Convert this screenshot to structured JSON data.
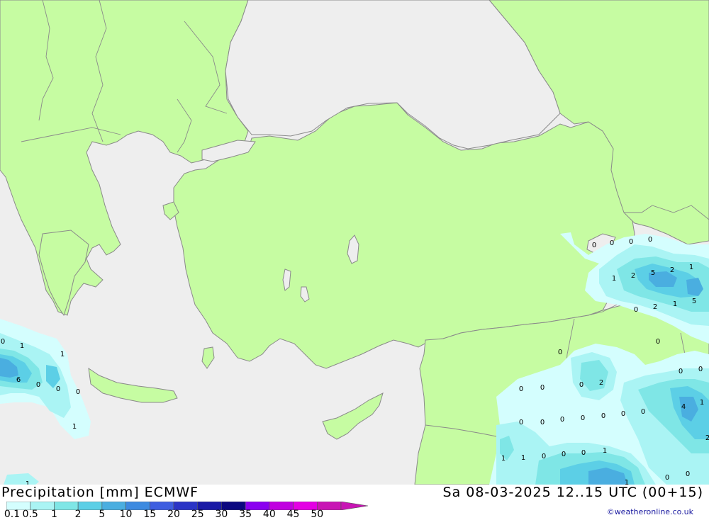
{
  "map": {
    "colors": {
      "sea": "#eeeeee",
      "land": "#c6fca2",
      "border": "#8a8a8a",
      "coast": "#8a8a8a"
    },
    "point_values": [
      {
        "label": "0"
      },
      {
        "label": "1"
      },
      {
        "label": "1"
      },
      {
        "label": "6"
      },
      {
        "label": "0"
      },
      {
        "label": "0"
      },
      {
        "label": "0"
      },
      {
        "label": "1"
      },
      {
        "label": "1"
      },
      {
        "label": "0"
      },
      {
        "label": "0"
      },
      {
        "label": "0"
      },
      {
        "label": "0"
      },
      {
        "label": "1"
      },
      {
        "label": "2"
      },
      {
        "label": "5"
      },
      {
        "label": "2"
      },
      {
        "label": "1"
      },
      {
        "label": "0"
      },
      {
        "label": "2"
      },
      {
        "label": "1"
      },
      {
        "label": "5"
      },
      {
        "label": "0"
      },
      {
        "label": "0"
      },
      {
        "label": "0"
      },
      {
        "label": "0"
      },
      {
        "label": "2"
      },
      {
        "label": "0"
      },
      {
        "label": "0"
      },
      {
        "label": "0"
      },
      {
        "label": "0"
      },
      {
        "label": "0"
      },
      {
        "label": "0"
      },
      {
        "label": "0"
      },
      {
        "label": "0"
      },
      {
        "label": "0"
      },
      {
        "label": "0"
      },
      {
        "label": "4"
      },
      {
        "label": "1"
      },
      {
        "label": "1"
      },
      {
        "label": "1"
      },
      {
        "label": "0"
      },
      {
        "label": "0"
      },
      {
        "label": "0"
      },
      {
        "label": "1"
      },
      {
        "label": "1"
      },
      {
        "label": "2"
      },
      {
        "label": "0"
      },
      {
        "label": "0"
      }
    ]
  },
  "footer": {
    "title": "Precipitation [mm] ECMWF",
    "datetime": "Sa 08-03-2025 12..15 UTC (00+15)",
    "credit": "©weatheronline.co.uk"
  },
  "legend": {
    "labels": [
      "0.1",
      "0.5",
      "1",
      "2",
      "5",
      "10",
      "15",
      "20",
      "25",
      "30",
      "35",
      "40",
      "45",
      "50"
    ],
    "colors": [
      "#d4fefe",
      "#aaf4f4",
      "#7fe6e6",
      "#5ccfe6",
      "#4aaee0",
      "#3d8ae0",
      "#3f5ee0",
      "#2b34c6",
      "#1a1aa6",
      "#0c0880",
      "#8a00f0",
      "#c000e0",
      "#e400e4",
      "#c814b4"
    ]
  }
}
